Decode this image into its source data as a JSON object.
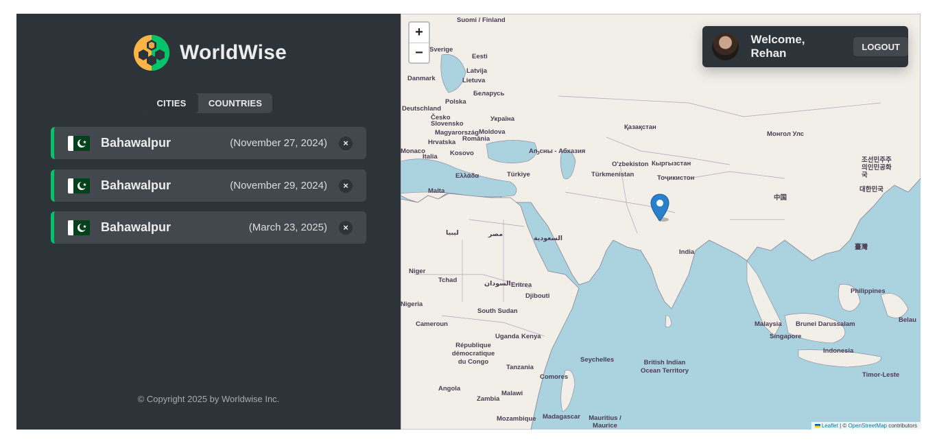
{
  "app": {
    "brand": "WorldWise",
    "tabs": [
      {
        "label": "CITIES",
        "active": true
      },
      {
        "label": "COUNTRIES",
        "active": false
      }
    ],
    "cities": [
      {
        "flag": "pakistan-flag",
        "name": "Bahawalpur",
        "date": "(November 27, 2024)"
      },
      {
        "flag": "pakistan-flag",
        "name": "Bahawalpur",
        "date": "(November 29, 2024)"
      },
      {
        "flag": "pakistan-flag",
        "name": "Bahawalpur",
        "date": "(March 23, 2025)"
      }
    ],
    "delete_glyph": "×",
    "footer": "© Copyright 2025 by Worldwise Inc."
  },
  "map": {
    "zoom_in": "+",
    "zoom_out": "−",
    "user": {
      "welcome": "Welcome, Rehan",
      "logout": "LOGOUT"
    },
    "attribution": {
      "leaflet": "Leaflet",
      "sep": " | © ",
      "osm": "OpenStreetMap",
      "suffix": " contributors"
    },
    "labels": [
      "Suomi / Finland",
      "Sverige",
      "Eesti",
      "Latvija",
      "Lietuva",
      "Danmark",
      "Беларусь",
      "Polska",
      "Deutschland",
      "Česko",
      "Slovensko",
      "Україна",
      "Magyarország",
      "Moldova",
      "România",
      "Hrvatska",
      "Italia",
      "Kosovo",
      "Monaco",
      "Ελλάδα",
      "Türkiye",
      "Malta",
      "Аҧсны - Абхазия",
      "Қазақстан",
      "O'zbekiston",
      "Кыргызстан",
      "Türkmenistan",
      "Тоҷикистон",
      "Монгол Улс",
      "中国",
      "조선민주주의인민공화국",
      "대한민국",
      "India",
      "ليبيا",
      "مصر",
      "السعودية",
      "Niger",
      "Tchad",
      "السودان",
      "Eritrea",
      "Djibouti",
      "Nigeria",
      "Cameroun",
      "South Sudan",
      "Uganda",
      "Kenya",
      "République démocratique du Congo",
      "Tanzania",
      "Angola",
      "Zambia",
      "Malawi",
      "Mozambique",
      "Madagascar",
      "Comores",
      "Seychelles",
      "British Indian Ocean Territory",
      "Mauritius / Maurice",
      "Malaysia",
      "Brunei Darussalam",
      "Singapore",
      "Indonesia",
      "Philippines",
      "Timor-Leste",
      "Belau",
      "臺灣"
    ]
  }
}
